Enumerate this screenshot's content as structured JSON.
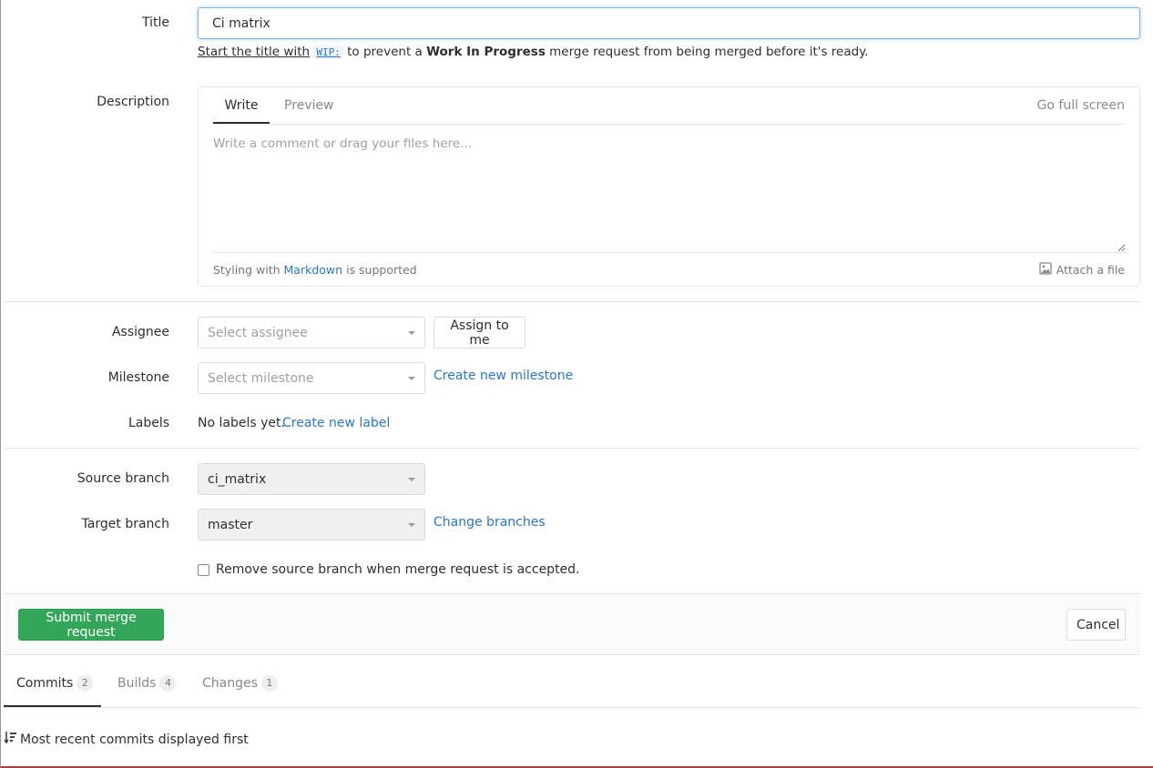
{
  "form": {
    "title_label": "Title",
    "title_value": "Ci matrix",
    "hint": {
      "prefix_link": "Start the title with",
      "code": "WIP:",
      "middle": "to prevent a",
      "bold": "Work In Progress",
      "suffix": "merge request from being merged before it's ready."
    },
    "description_label": "Description",
    "editor": {
      "tab_write": "Write",
      "tab_preview": "Preview",
      "full_screen": "Go full screen",
      "placeholder": "Write a comment or drag your files here...",
      "styling_prefix": "Styling with",
      "markdown_link": "Markdown",
      "styling_suffix": "is supported",
      "attach": "Attach a file"
    },
    "assignee_label": "Assignee",
    "assignee_placeholder": "Select assignee",
    "assign_to_me": "Assign to me",
    "milestone_label": "Milestone",
    "milestone_placeholder": "Select milestone",
    "create_milestone": "Create new milestone",
    "labels_label": "Labels",
    "no_labels": "No labels yet.",
    "create_label": "Create new label",
    "source_branch_label": "Source branch",
    "source_branch_value": "ci_matrix",
    "target_branch_label": "Target branch",
    "target_branch_value": "master",
    "change_branches": "Change branches",
    "remove_source_label": "Remove source branch when merge request is accepted.",
    "remove_source_checked": false
  },
  "actions": {
    "submit": "Submit merge request",
    "cancel": "Cancel"
  },
  "mr_tabs": [
    {
      "label": "Commits",
      "count": "2",
      "active": true
    },
    {
      "label": "Builds",
      "count": "4",
      "active": false
    },
    {
      "label": "Changes",
      "count": "1",
      "active": false
    }
  ],
  "commits_note": "Most recent commits displayed first",
  "colors": {
    "link": "#2b77c2",
    "submit_green": "#33a659",
    "focus_border": "#7fb2e6"
  }
}
